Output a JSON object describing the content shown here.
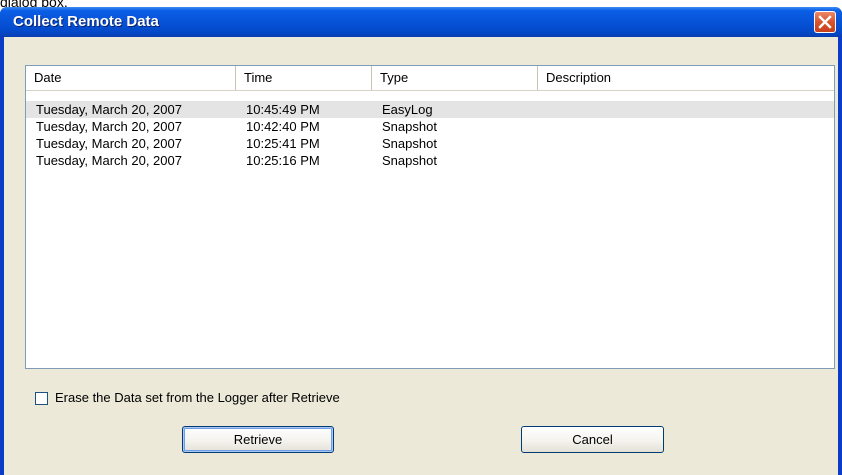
{
  "background_caption": "dialog box.",
  "dialog": {
    "title": "Collect Remote Data",
    "close_icon": "close-icon"
  },
  "list": {
    "columns": [
      {
        "label": "Date"
      },
      {
        "label": "Time"
      },
      {
        "label": "Type"
      },
      {
        "label": "Description"
      }
    ],
    "rows": [
      {
        "date": "Tuesday, March 20, 2007",
        "time": "10:45:49 PM",
        "type": "EasyLog",
        "description": "",
        "selected": true
      },
      {
        "date": "Tuesday, March 20, 2007",
        "time": "10:42:40 PM",
        "type": "Snapshot",
        "description": "",
        "selected": false
      },
      {
        "date": "Tuesday, March 20, 2007",
        "time": "10:25:41 PM",
        "type": "Snapshot",
        "description": "",
        "selected": false
      },
      {
        "date": "Tuesday, March 20, 2007",
        "time": "10:25:16 PM",
        "type": "Snapshot",
        "description": "",
        "selected": false
      }
    ]
  },
  "erase_option": {
    "label": "Erase the Data set from the Logger after Retrieve",
    "checked": false
  },
  "buttons": {
    "retrieve_label": "Retrieve",
    "cancel_label": "Cancel"
  },
  "colors": {
    "titlebar": "#0854d8",
    "client_bg": "#ece9d8",
    "close_button": "#d9532b",
    "selected_row": "#e4e4e4"
  }
}
